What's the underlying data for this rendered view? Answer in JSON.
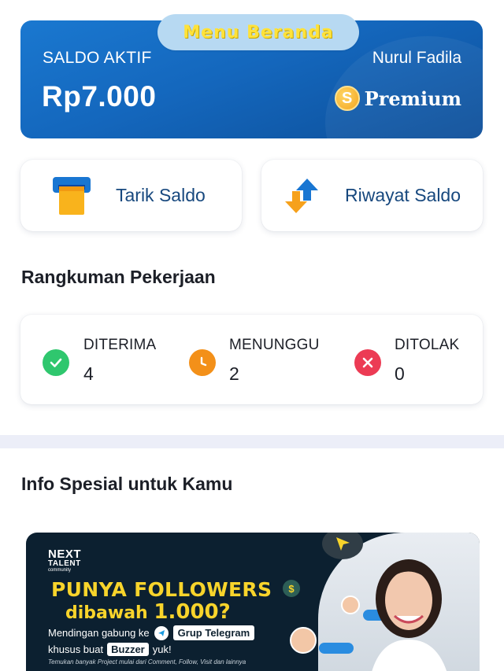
{
  "overlay": {
    "sticker_text": "Menu Beranda"
  },
  "balance": {
    "label": "SALDO AKTIF",
    "user_name": "Nurul Fadila",
    "amount": "Rp7.000",
    "tier_badge_letter": "S",
    "tier_label": "Premium"
  },
  "actions": {
    "withdraw_label": "Tarik Saldo",
    "history_label": "Riwayat Saldo"
  },
  "summary": {
    "title": "Rangkuman Pekerjaan",
    "items": [
      {
        "label": "DITERIMA",
        "value": "4",
        "icon": "check-circle-icon",
        "color": "#2fc76e"
      },
      {
        "label": "MENUNGGU",
        "value": "2",
        "icon": "clock-icon",
        "color": "#f39019"
      },
      {
        "label": "DITOLAK",
        "value": "0",
        "icon": "x-circle-icon",
        "color": "#ec3b54"
      }
    ]
  },
  "special": {
    "title": "Info Spesial untuk Kamu",
    "banner": {
      "brand_line1": "NEXT",
      "brand_line2": "TALENT",
      "brand_line3": "community",
      "headline1": "PUNYA FOLLOWERS",
      "headline2_a": "dibawah",
      "headline2_b": "1.000",
      "headline2_c": "?",
      "line3_a": "Mendingan gabung ke",
      "line3_pill": "Grup Telegram",
      "line4_a": "khusus buat",
      "line4_pill": "Buzzer",
      "line4_b": "yuk!",
      "line5": "Temukan banyak Project mulai dari Comment, Follow, Visit dan lainnya"
    }
  },
  "colors": {
    "card_blue": "#1467bd",
    "action_text": "#17487e",
    "sticker_text": "#ffe23a",
    "divider": "#eceef8"
  }
}
